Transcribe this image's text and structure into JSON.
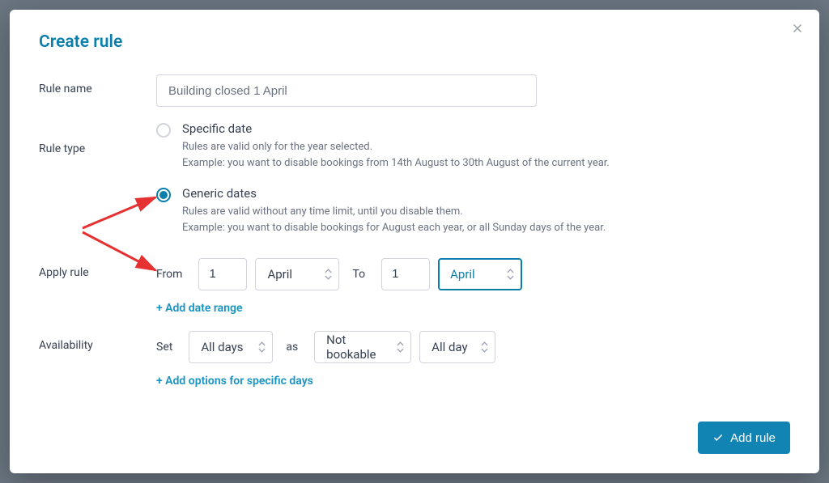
{
  "modal": {
    "title": "Create rule"
  },
  "labels": {
    "rule_name": "Rule name",
    "rule_type": "Rule type",
    "apply_rule": "Apply rule",
    "availability": "Availability",
    "from": "From",
    "to": "To",
    "set": "Set",
    "as": "as"
  },
  "rule_name_value": "Building closed 1 April",
  "rule_type": {
    "specific": {
      "title": "Specific date",
      "desc1": "Rules are valid only for the year selected.",
      "desc2": "Example: you want to disable bookings from 14th August to 30th August of the current year."
    },
    "generic": {
      "title": "Generic dates",
      "desc1": "Rules are valid without any time limit, until you disable them.",
      "desc2": "Example: you want to disable bookings for August each year, or all Sunday days of the year."
    }
  },
  "range": {
    "from_day": "1",
    "from_month": "April",
    "to_day": "1",
    "to_month": "April",
    "add_link": "+ Add date range"
  },
  "availability": {
    "days": "All days",
    "state": "Not bookable",
    "time": "All day",
    "add_link": "+ Add options for specific days"
  },
  "footer": {
    "add_rule": "Add rule"
  }
}
